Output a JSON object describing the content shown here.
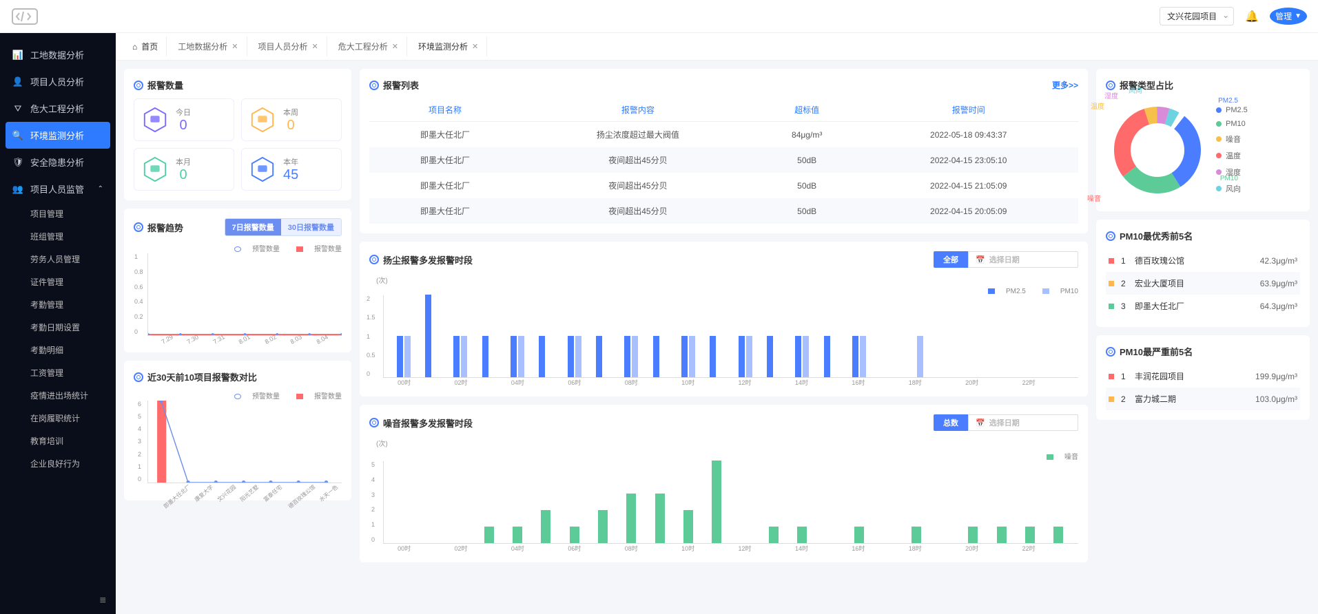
{
  "header": {
    "project_selector": "文兴花园项目",
    "user_label": "管理"
  },
  "sidebar": {
    "items": [
      {
        "icon": "bar",
        "label": "工地数据分析"
      },
      {
        "icon": "user",
        "label": "项目人员分析"
      },
      {
        "icon": "filter",
        "label": "危大工程分析"
      },
      {
        "icon": "env",
        "label": "环境监测分析",
        "active": true
      },
      {
        "icon": "shield",
        "label": "安全隐患分析"
      },
      {
        "icon": "users",
        "label": "项目人员监管",
        "expandable": true
      }
    ],
    "subs": [
      "项目管理",
      "班组管理",
      "劳务人员管理",
      "证件管理",
      "考勤管理",
      "考勤日期设置",
      "考勤明细",
      "工资管理",
      "疫情进出场统计",
      "在岗履职统计",
      "教育培训",
      "企业良好行为"
    ]
  },
  "tabs": {
    "home": "首页",
    "items": [
      "工地数据分析",
      "项目人员分析",
      "危大工程分析",
      "环境监测分析"
    ],
    "active_index": 3
  },
  "alarm_count": {
    "title": "报警数量",
    "boxes": [
      {
        "label": "今日",
        "value": "0",
        "color": "#7a6bff"
      },
      {
        "label": "本周",
        "value": "0",
        "color": "#ffb74d"
      },
      {
        "label": "本月",
        "value": "0",
        "color": "#4dd0a8"
      },
      {
        "label": "本年",
        "value": "45",
        "color": "#4a7dff"
      }
    ]
  },
  "alarm_list": {
    "title": "报警列表",
    "more": "更多>>",
    "headers": [
      "项目名称",
      "报警内容",
      "超标值",
      "报警时间"
    ],
    "rows": [
      [
        "即墨大任北厂",
        "扬尘浓度超过最大阀值",
        "84μg/m³",
        "2022-05-18 09:43:37"
      ],
      [
        "即墨大任北厂",
        "夜间超出45分贝",
        "50dB",
        "2022-04-15 23:05:10"
      ],
      [
        "即墨大任北厂",
        "夜间超出45分贝",
        "50dB",
        "2022-04-15 21:05:09"
      ],
      [
        "即墨大任北厂",
        "夜间超出45分贝",
        "50dB",
        "2022-04-15 20:05:09"
      ]
    ]
  },
  "alarm_type": {
    "title": "报警类型占比",
    "legend": [
      {
        "label": "PM2.5",
        "color": "#4a7dff"
      },
      {
        "label": "PM10",
        "color": "#5dcb97"
      },
      {
        "label": "噪音",
        "color": "#f7c04a"
      },
      {
        "label": "温度",
        "color": "#ff6b6b"
      },
      {
        "label": "湿度",
        "color": "#d88bd9"
      },
      {
        "label": "风向",
        "color": "#6dd3e0"
      }
    ],
    "slice_labels": [
      "PM2.5",
      "PM10",
      "噪音",
      "温度",
      "湿度",
      "风向"
    ]
  },
  "alarm_trend": {
    "title": "报警趋势",
    "toggle": [
      "7日报警数量",
      "30日报警数量"
    ],
    "legend": [
      "预警数量",
      "报警数量"
    ],
    "x": [
      "7.29",
      "7.30",
      "7.31",
      "8.01",
      "8.02",
      "8.03",
      "8.04"
    ],
    "y_ticks": [
      "0",
      "0.2",
      "0.4",
      "0.6",
      "0.8",
      "1"
    ]
  },
  "dust_period": {
    "title": "扬尘报警多发报警时段",
    "btn": "全部",
    "placeholder": "选择日期",
    "y_unit": "(次)",
    "legend": [
      "PM2.5",
      "PM10"
    ],
    "x": [
      "00时",
      "",
      "02时",
      "",
      "04时",
      "",
      "06时",
      "",
      "08时",
      "",
      "10时",
      "",
      "12时",
      "",
      "14时",
      "",
      "16时",
      "",
      "18时",
      "",
      "20时",
      "",
      "22时",
      ""
    ]
  },
  "noise_period": {
    "title": "噪音报警多发报警时段",
    "btn": "总数",
    "placeholder": "选择日期",
    "y_unit": "(次)",
    "legend": [
      "噪音"
    ],
    "x": [
      "00时",
      "",
      "02时",
      "",
      "04时",
      "",
      "06时",
      "",
      "08时",
      "",
      "10时",
      "",
      "12时",
      "",
      "14时",
      "",
      "16时",
      "",
      "18时",
      "",
      "20时",
      "",
      "22时",
      ""
    ]
  },
  "compare30": {
    "title": "近30天前10项目报警数对比",
    "legend": [
      "预警数量",
      "报警数量"
    ],
    "x": [
      "即墨大任北厂",
      "康复大学",
      "文兴花园",
      "阳光艺墅",
      "富泰任宅",
      "德百玫瑰公馆",
      "水天一色"
    ],
    "y_ticks": [
      "0",
      "1",
      "2",
      "3",
      "4",
      "5",
      "6"
    ]
  },
  "pm10_best": {
    "title": "PM10最优秀前5名",
    "rows": [
      {
        "rank": "1",
        "name": "德百玫瑰公馆",
        "value": "42.3μg/m³",
        "color": "#ff6b6b"
      },
      {
        "rank": "2",
        "name": "宏业大厦项目",
        "value": "63.9μg/m³",
        "color": "#ffb74d"
      },
      {
        "rank": "3",
        "name": "即墨大任北厂",
        "value": "64.3μg/m³",
        "color": "#5dcb97"
      }
    ]
  },
  "pm10_worst": {
    "title": "PM10最严重前5名",
    "rows": [
      {
        "rank": "1",
        "name": "丰润花园项目",
        "value": "199.9μg/m³",
        "color": "#ff6b6b"
      },
      {
        "rank": "2",
        "name": "富力城二期",
        "value": "103.0μg/m³",
        "color": "#ffb74d"
      }
    ]
  },
  "chart_data": {
    "alarm_trend": {
      "type": "line",
      "x": [
        "7.29",
        "7.30",
        "7.31",
        "8.01",
        "8.02",
        "8.03",
        "8.04"
      ],
      "series": [
        {
          "name": "预警数量",
          "values": [
            0,
            0,
            0,
            0,
            0,
            0,
            0
          ]
        },
        {
          "name": "报警数量",
          "values": [
            0,
            0,
            0,
            0,
            0,
            0,
            0
          ]
        }
      ],
      "ylim": [
        0,
        1
      ]
    },
    "dust_period": {
      "type": "bar",
      "categories": [
        "00",
        "01",
        "02",
        "03",
        "04",
        "05",
        "06",
        "07",
        "08",
        "09",
        "10",
        "11",
        "12",
        "13",
        "14",
        "15",
        "16",
        "17",
        "18",
        "19",
        "20",
        "21",
        "22",
        "23"
      ],
      "series": [
        {
          "name": "PM2.5",
          "values": [
            1,
            2,
            1,
            1,
            1,
            1,
            1,
            1,
            1,
            1,
            1,
            1,
            1,
            1,
            1,
            1,
            1,
            0,
            0,
            0,
            0,
            0,
            0,
            0
          ]
        },
        {
          "name": "PM10",
          "values": [
            1,
            0,
            1,
            0,
            1,
            0,
            1,
            0,
            1,
            0,
            1,
            0,
            1,
            0,
            1,
            0,
            1,
            0,
            1,
            0,
            0,
            0,
            0,
            0
          ]
        }
      ],
      "ylim": [
        0,
        2
      ]
    },
    "noise_period": {
      "type": "bar",
      "categories": [
        "00",
        "01",
        "02",
        "03",
        "04",
        "05",
        "06",
        "07",
        "08",
        "09",
        "10",
        "11",
        "12",
        "13",
        "14",
        "15",
        "16",
        "17",
        "18",
        "19",
        "20",
        "21",
        "22",
        "23"
      ],
      "series": [
        {
          "name": "噪音",
          "values": [
            0,
            0,
            0,
            1,
            1,
            2,
            1,
            2,
            3,
            3,
            2,
            5,
            0,
            1,
            1,
            0,
            1,
            0,
            1,
            0,
            1,
            1,
            1,
            1
          ]
        }
      ],
      "ylim": [
        0,
        5
      ]
    },
    "compare30": {
      "type": "line+bar",
      "categories": [
        "即墨大任北厂",
        "康复大学",
        "文兴花园",
        "阳光艺墅",
        "富泰任宅",
        "德百玫瑰公馆",
        "水天一色"
      ],
      "series": [
        {
          "name": "报警数量",
          "type": "bar",
          "values": [
            6,
            0,
            0,
            0,
            0,
            0,
            0
          ]
        },
        {
          "name": "预警数量",
          "type": "line",
          "values": [
            6,
            0,
            0,
            0,
            0,
            0,
            0
          ]
        }
      ],
      "ylim": [
        0,
        6
      ]
    },
    "alarm_type_donut": {
      "type": "pie",
      "slices": [
        {
          "name": "PM2.5",
          "value": 30,
          "color": "#4a7dff"
        },
        {
          "name": "PM10",
          "value": 25,
          "color": "#5dcb97"
        },
        {
          "name": "噪音",
          "value": 30,
          "color": "#ff6b6b"
        },
        {
          "name": "温度",
          "value": 5,
          "color": "#f7c04a"
        },
        {
          "name": "湿度",
          "value": 5,
          "color": "#d88bd9"
        },
        {
          "name": "风向",
          "value": 5,
          "color": "#6dd3e0"
        }
      ]
    }
  }
}
